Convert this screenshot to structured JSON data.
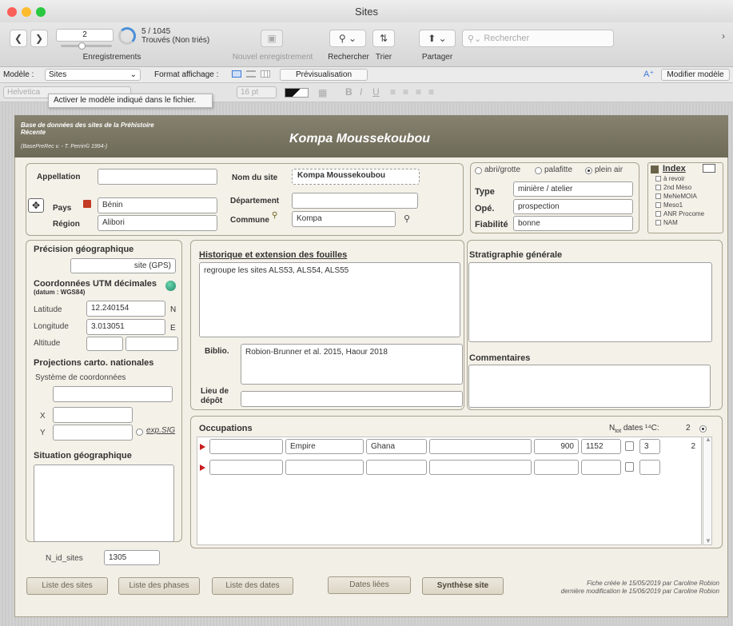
{
  "window": {
    "title": "Sites"
  },
  "colors": {
    "header_bg": "#7b7764",
    "panel_bg": "#f4f1e8",
    "accent_red": "#c81d1d",
    "light_red": "#fc5f57",
    "light_yellow": "#fdbc2e",
    "light_green": "#28c840"
  },
  "toolbar": {
    "record_index": "2",
    "record_count": "5 / 1045",
    "found_status": "Trouvés (Non triés)",
    "records_label": "Enregistrements",
    "new_record_label": "Nouvel enregistrement",
    "search_label": "Rechercher",
    "sort_label": "Trier",
    "share_label": "Partager",
    "search_placeholder": "Rechercher",
    "progress_fraction": 0.7
  },
  "layoutbar": {
    "model_label": "Modèle :",
    "model_value": "Sites",
    "display_format_label": "Format affichage :",
    "preview_label": "Prévisualisation",
    "edit_model_label": "Modifier modèle"
  },
  "formatbar": {
    "font_value": "Helvetica",
    "size_value": "16 pt"
  },
  "tooltip": "Activer le modèle indiqué dans le fichier.",
  "header": {
    "db_title": "Base de données des sites de la Préhistoire Récente",
    "db_sub": "(BasePreRec v. - T. Perrin© 1994-)",
    "site_title": "Kompa Moussekoubou"
  },
  "ident": {
    "appellation_label": "Appellation",
    "appellation_value": "",
    "site_name_label": "Nom du site",
    "site_name_value": "Kompa Moussekoubou",
    "country_label": "Pays",
    "country_value": "Bénin",
    "dept_label": "Département",
    "dept_value": "",
    "region_label": "Région",
    "region_value": "Alibori",
    "commune_label": "Commune",
    "commune_value": "Kompa"
  },
  "sitetype": {
    "option1": "abri/grotte",
    "option2": "palafitte",
    "option3": "plein air",
    "type_label": "Type",
    "type_value": "minière / atelier",
    "ope_label": "Opé.",
    "ope_value": "prospection",
    "reliability_label": "Fiabilité",
    "reliability_value": "bonne"
  },
  "index": {
    "title": "Index",
    "items": [
      "à revoir",
      "2nd Méso",
      "MeNeMOIA",
      "Meso1",
      "ANR Procome",
      "NAM"
    ]
  },
  "geo": {
    "precision_label": "Précision géographique",
    "precision_value": "site (GPS)",
    "utm_label": "Coordonnées UTM décimales",
    "datum_label": "(datum : WGS84)",
    "lat_label": "Latitude",
    "lat_value": "12.240154",
    "lat_unit": "N",
    "lon_label": "Longitude",
    "lon_value": "3.013051",
    "lon_unit": "E",
    "alt_label": "Altitude",
    "proj_label": "Projections carto. nationales",
    "coord_system_label": "Système de coordonnées",
    "x_label": "X",
    "y_label": "Y",
    "export_label": "exp.SIG",
    "situation_label": "Situation géographique"
  },
  "history": {
    "label": "Historique et extension des fouilles",
    "value": "regroupe les sites ALS53, ALS54, ALS55",
    "biblio_label": "Biblio.",
    "biblio_value": "Robion-Brunner et al. 2015, Haour 2018",
    "deposit_label": "Lieu de dépôt"
  },
  "strati": {
    "label": "Stratigraphie générale",
    "comments_label": "Commentaires"
  },
  "occupations": {
    "label": "Occupations",
    "dates_label": "N",
    "dates_sub": "tot",
    "dates_unit": "dates ¹⁴C:",
    "dates_count": "2",
    "rows": [
      {
        "c1": "",
        "c2": "Empire",
        "c3": "Ghana",
        "c4": "",
        "from": "900",
        "to": "1152",
        "n": "3",
        "count": "2"
      },
      {
        "c1": "",
        "c2": "",
        "c3": "",
        "c4": "",
        "from": "",
        "to": "",
        "n": "",
        "count": ""
      }
    ]
  },
  "footer": {
    "nid_label": "N_id_sites",
    "nid_value": "1305",
    "btn_sites": "Liste des sites",
    "btn_phases": "Liste des phases",
    "btn_dates": "Liste des dates",
    "btn_linked": "Dates liées",
    "btn_synth": "Synthèse site",
    "created": "Fiche créée le 15/05/2019 par Caroline Robion",
    "modified": "dernière modification le 15/06/2019 par Caroline Robion"
  }
}
